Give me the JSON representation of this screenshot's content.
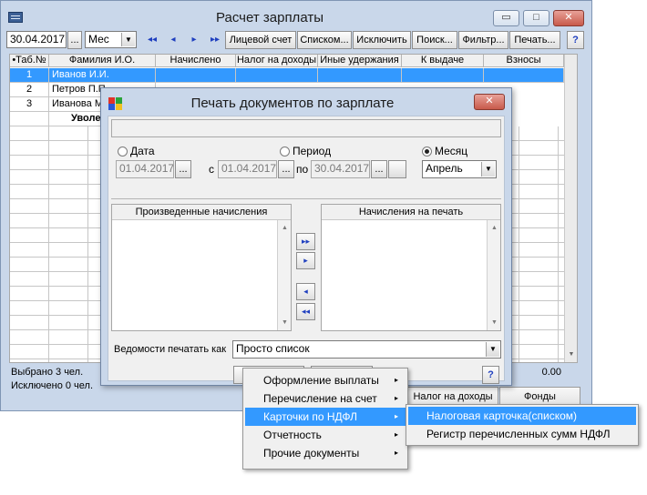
{
  "main": {
    "title": "Расчет зарплаты",
    "controls": {
      "minimize": "▭",
      "maximize": "□",
      "close": "✕"
    },
    "toolbar": {
      "date": "30.04.2017",
      "date_picker": "...",
      "period": "Мес",
      "nav": [
        "◂◂",
        "◂",
        "▸",
        "▸▸"
      ],
      "buttons": [
        "Лицевой счет",
        "Списком...",
        "Исключить",
        "Поиск...",
        "Фильтр...",
        "Печать..."
      ],
      "help": "?"
    },
    "grid": {
      "columns": [
        "•Таб.№",
        "Фамилия И.О.",
        "Начислено",
        "Налог на доходы",
        "Иные удержания",
        "К выдаче",
        "Взносы"
      ],
      "rows": [
        {
          "num": "1",
          "name": "Иванов И.И."
        },
        {
          "num": "2",
          "name": "Петров П.П."
        },
        {
          "num": "3",
          "name": "Иванова М."
        },
        {
          "num": "",
          "name": "Уволе"
        }
      ]
    },
    "status": {
      "selected": "Выбрано 3 чел.",
      "excluded": "Исключено 0 чел.",
      "total": "0.00"
    },
    "tabs": [
      "Налог на доходы",
      "Фонды"
    ]
  },
  "dialog": {
    "title": "Печать документов по зарплате",
    "close": "✕",
    "date_label": "Дата",
    "date_value": "01.04.2017",
    "period_label": "Период",
    "from_label": "с",
    "from_value": "01.04.2017",
    "to_label": "по",
    "to_value": "30.04.2017",
    "month_label": "Месяц",
    "month_value": "Апрель",
    "dots": "...",
    "left_panel": "Произведенные начисления",
    "right_panel": "Начисления на печать",
    "transfer": {
      "all_right": "▸▸",
      "right": "▸",
      "left": "◂",
      "all_left": "◂◂"
    },
    "print_as_label": "Ведомости печатать как",
    "print_as_value": "Просто список",
    "help": "?"
  },
  "menu": {
    "items": [
      {
        "label": "Оформление выплаты",
        "arrow": "▸"
      },
      {
        "label": "Перечисление на счет",
        "arrow": "▸"
      },
      {
        "label": "Карточки по НДФЛ",
        "arrow": "▸"
      },
      {
        "label": "Отчетность",
        "arrow": "▸"
      },
      {
        "label": "Прочие документы",
        "arrow": "▸"
      }
    ]
  },
  "submenu": {
    "items": [
      "Налоговая карточка(списком)",
      "Регистр перечисленных сумм НДФЛ"
    ]
  },
  "arrows": {
    "up": "▲",
    "down": "▼"
  },
  "colors": {
    "selection": "#3399ff",
    "window": "#c9d7ea",
    "close": "#c85a4b"
  }
}
